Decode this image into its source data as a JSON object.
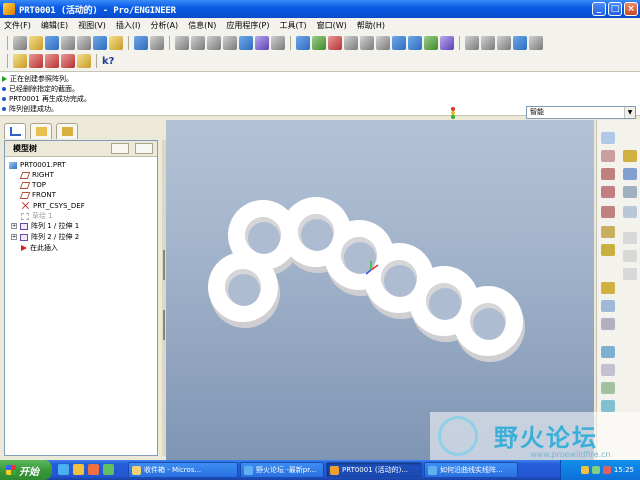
{
  "window": {
    "title": "PRT0001 (活动的) - Pro/ENGINEER"
  },
  "menu": [
    "文件(F)",
    "编辑(E)",
    "视图(V)",
    "插入(I)",
    "分析(A)",
    "信息(N)",
    "应用程序(P)",
    "工具(T)",
    "窗口(W)",
    "帮助(H)"
  ],
  "messages": [
    {
      "icon": "arrow",
      "text": "正在创建参照阵列。"
    },
    {
      "icon": "dot",
      "text": "已经删除指定的截面。"
    },
    {
      "icon": "dot",
      "text": "PRT0001 再生成功完成。"
    },
    {
      "icon": "dot",
      "text": "阵列创建成功。"
    }
  ],
  "filter": {
    "value": "智能"
  },
  "model_tree": {
    "header": "模型树",
    "items": [
      {
        "label": "PRT0001.PRT",
        "icon": "part"
      },
      {
        "label": "RIGHT",
        "icon": "plane"
      },
      {
        "label": "TOP",
        "icon": "plane"
      },
      {
        "label": "FRONT",
        "icon": "plane"
      },
      {
        "label": "PRT_CSYS_DEF",
        "icon": "csys"
      },
      {
        "label": "草绘 1",
        "icon": "sketch"
      },
      {
        "label": "阵列 1 / 拉伸 1",
        "icon": "pattern"
      },
      {
        "label": "阵列 2 / 拉伸 2",
        "icon": "pattern"
      },
      {
        "label": "在此插入",
        "icon": "insert"
      }
    ]
  },
  "watermark": {
    "text": "野火论坛",
    "url": "www.proewildfire.cn"
  },
  "taskbar": {
    "start": "开始",
    "tasks": [
      "收件箱 - Micros...",
      "野火论坛 -最新pr...",
      "PRT0001 (活动的)...",
      "如何沿曲线实线阵..."
    ],
    "clock": "15:25"
  },
  "colors": {
    "graphics_top": "#b4c2d6",
    "graphics_bottom": "#7f95b4",
    "part_face": "#ffffff",
    "part_side": "#d8d8d8"
  }
}
